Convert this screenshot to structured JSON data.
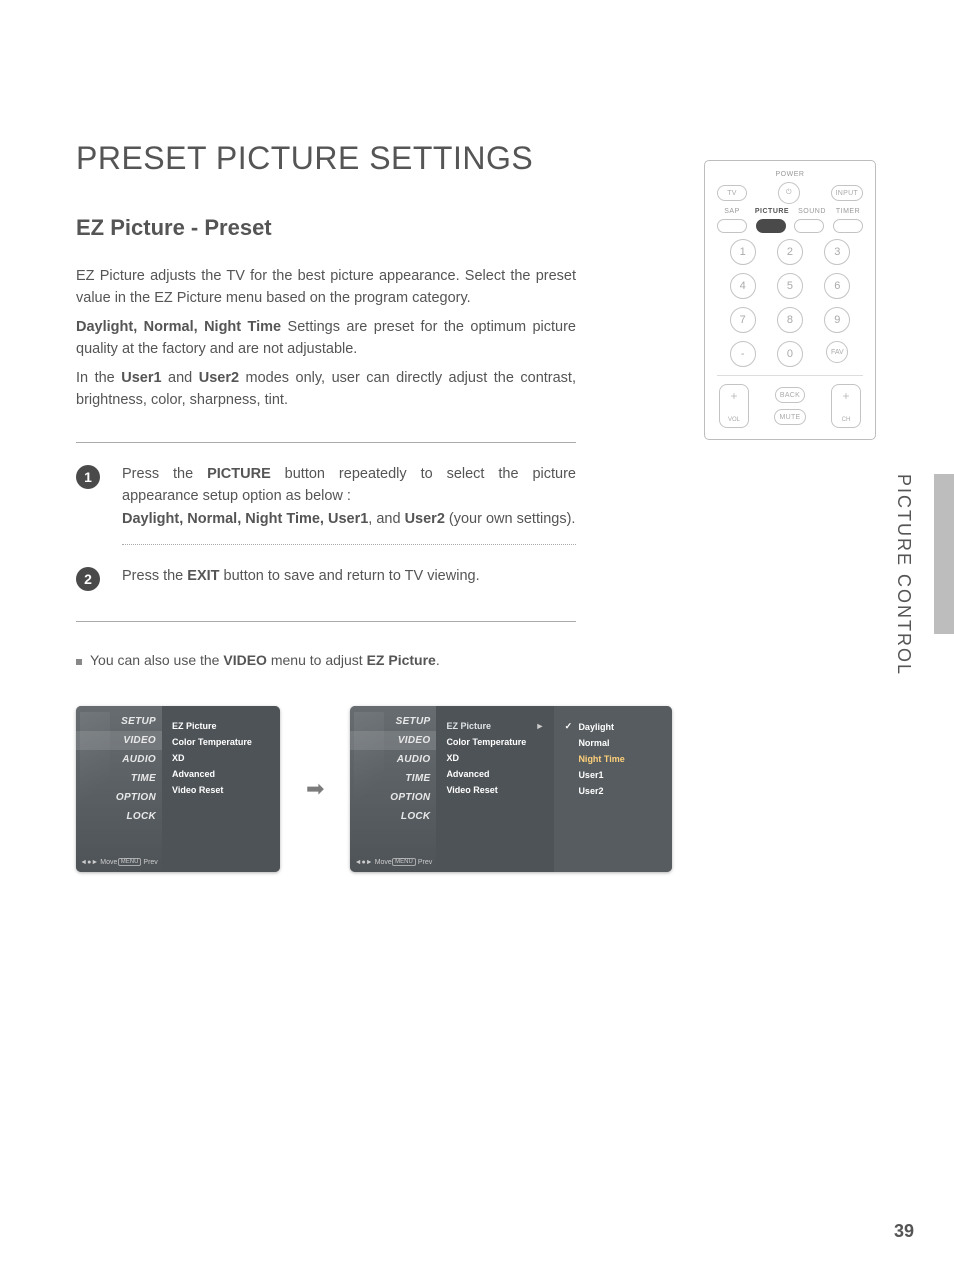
{
  "title": "PRESET PICTURE SETTINGS",
  "subtitle": "EZ Picture - Preset",
  "intro": {
    "p1": "EZ Picture adjusts the TV for the best picture appearance. Select the preset value in the EZ Picture menu based on the program category.",
    "p2_bold": "Daylight, Normal, Night Time",
    "p2_rest": " Settings are preset for the optimum picture quality at the factory and are not adjustable.",
    "p3_a": "In the ",
    "p3_b1": "User1",
    "p3_mid": " and ",
    "p3_b2": "User2",
    "p3_rest": " modes only, user can directly adjust the contrast, brightness, color, sharpness, tint."
  },
  "step1": {
    "a": "Press the ",
    "b": "PICTURE",
    "c": " button repeatedly to select the picture appearance setup option as below :",
    "list_bold": "Daylight, Normal, Night Time, User1",
    "list_mid": ", and ",
    "list_last": "User2",
    "tail": " (your own settings)."
  },
  "step2": {
    "a": "Press the ",
    "b": "EXIT",
    "c": " button to save and return to TV viewing."
  },
  "note": {
    "a": "You can also use the ",
    "b": "VIDEO",
    "c": " menu to adjust ",
    "d": "EZ Picture",
    "e": "."
  },
  "osd": {
    "nav": [
      "SETUP",
      "VIDEO",
      "AUDIO",
      "TIME",
      "OPTION",
      "LOCK"
    ],
    "video_items": [
      "EZ Picture",
      "Color Temperature",
      "XD",
      "Advanced",
      "Video Reset"
    ],
    "presets": [
      "Daylight",
      "Normal",
      "Night Time",
      "User1",
      "User2"
    ],
    "foot_move": "Move",
    "foot_prev": "Prev",
    "foot_menu": "MENU"
  },
  "remote": {
    "power": "POWER",
    "tv": "TV",
    "input": "INPUT",
    "sap": "SAP",
    "picture": "PICTURE",
    "sound": "SOUND",
    "timer": "TIMER",
    "numbers": [
      "1",
      "2",
      "3",
      "4",
      "5",
      "6",
      "7",
      "8",
      "9",
      "-",
      "0",
      "FAV"
    ],
    "back": "BACK",
    "mute": "MUTE",
    "vol": "VOL",
    "ch": "CH"
  },
  "side_label": "PICTURE CONTROL",
  "page_number": "39"
}
